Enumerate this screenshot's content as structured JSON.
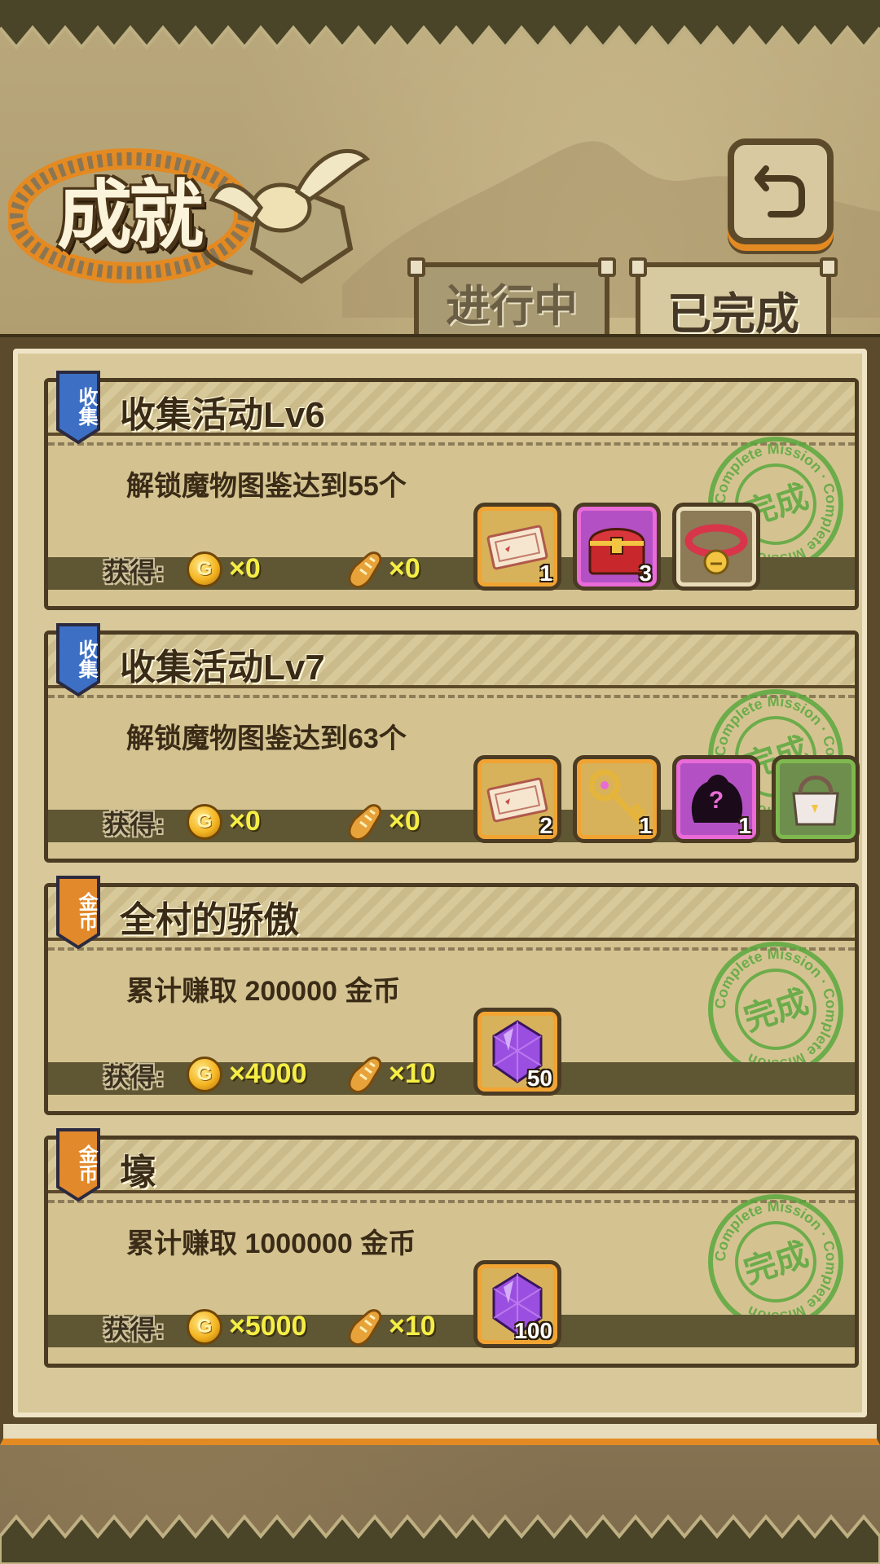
{
  "header": {
    "title": "成就",
    "tabs": [
      {
        "label": "进行中",
        "active": false
      },
      {
        "label": "已完成",
        "active": true
      }
    ]
  },
  "stamp": {
    "text": "完成",
    "ring_text": "Complete Mission"
  },
  "reward_label": "获得:",
  "achievements": [
    {
      "tag": "收集",
      "tag_color": "#3d6fc4",
      "title": "收集活动Lv6",
      "desc": "解锁魔物图鉴达到55个",
      "gold": "×0",
      "bread": "×0",
      "items": [
        {
          "icon": "ticket-icon",
          "count": "1",
          "frame": "gold"
        },
        {
          "icon": "treasure-chest-icon",
          "count": "3",
          "frame": "purple"
        },
        {
          "icon": "bell-collar-icon",
          "count": "",
          "frame": "plain"
        }
      ]
    },
    {
      "tag": "收集",
      "tag_color": "#3d6fc4",
      "title": "收集活动Lv7",
      "desc": "解锁魔物图鉴达到63个",
      "gold": "×0",
      "bread": "×0",
      "items": [
        {
          "icon": "ticket-icon",
          "count": "2",
          "frame": "gold"
        },
        {
          "icon": "key-icon",
          "count": "1",
          "frame": "gold"
        },
        {
          "icon": "mystery-monster-icon",
          "count": "1",
          "frame": "purple"
        },
        {
          "icon": "bag-icon",
          "count": "",
          "frame": "green"
        }
      ]
    },
    {
      "tag": "金币",
      "tag_color": "#e2892b",
      "title": "全村的骄傲",
      "desc": "累计赚取 200000 金币",
      "gold": "×4000",
      "bread": "×10",
      "items": [
        {
          "icon": "purple-gem-icon",
          "count": "50",
          "frame": "gold"
        }
      ]
    },
    {
      "tag": "金币",
      "tag_color": "#e2892b",
      "title": "壕",
      "desc": "累计赚取 1000000 金币",
      "gold": "×5000",
      "bread": "×10",
      "items": [
        {
          "icon": "purple-gem-icon",
          "count": "100",
          "frame": "gold"
        }
      ]
    }
  ],
  "coin_letter": "G"
}
